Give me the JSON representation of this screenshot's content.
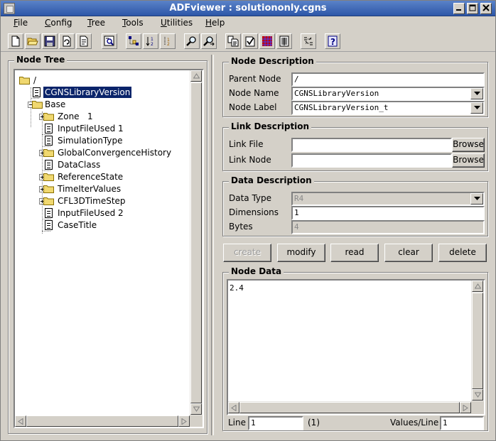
{
  "window": {
    "title": "ADFviewer : solutiononly.cgns",
    "controls": [
      "minimize",
      "maximize",
      "close"
    ]
  },
  "menu": [
    {
      "label": "File",
      "mnemonic": "F",
      "rest": "ile"
    },
    {
      "label": "Config",
      "mnemonic": "C",
      "rest": "onfig"
    },
    {
      "label": "Tree",
      "mnemonic": "T",
      "rest": "ree"
    },
    {
      "label": "Tools",
      "mnemonic": "T",
      "rest": "ools"
    },
    {
      "label": "Utilities",
      "mnemonic": "U",
      "rest": "tilities"
    },
    {
      "label": "Help",
      "mnemonic": "H",
      "rest": "elp"
    }
  ],
  "toolbar_icons": [
    "new-file-icon",
    "open-folder-icon",
    "save-icon",
    "refresh-icon",
    "properties-icon",
    "find-node-icon",
    "tree-expand-icon",
    "tree-sort-icon",
    "tree-numbers-icon",
    "search-icon",
    "search-next-icon",
    "copy-icon",
    "check-icon",
    "plot-icon",
    "table-icon",
    "compare-icon",
    "help-icon"
  ],
  "node_tree": {
    "title": "Node Tree",
    "items": [
      {
        "label": "/",
        "type": "folder",
        "depth": 0
      },
      {
        "label": "CGNSLibraryVersion",
        "type": "doc",
        "depth": 1,
        "selected": true
      },
      {
        "label": "Base",
        "type": "folder",
        "depth": 1,
        "expanded": true
      },
      {
        "label": "Zone   1",
        "type": "folder",
        "depth": 2
      },
      {
        "label": "InputFileUsed 1",
        "type": "doc",
        "depth": 2
      },
      {
        "label": "SimulationType",
        "type": "doc",
        "depth": 2
      },
      {
        "label": "GlobalConvergenceHistory",
        "type": "folder",
        "depth": 2
      },
      {
        "label": "DataClass",
        "type": "doc",
        "depth": 2
      },
      {
        "label": "ReferenceState",
        "type": "folder",
        "depth": 2
      },
      {
        "label": "TimeIterValues",
        "type": "folder",
        "depth": 2
      },
      {
        "label": "CFL3DTimeStep",
        "type": "folder",
        "depth": 2
      },
      {
        "label": "InputFileUsed 2",
        "type": "doc",
        "depth": 2
      },
      {
        "label": "CaseTitle",
        "type": "doc",
        "depth": 2
      }
    ]
  },
  "node_description": {
    "title": "Node Description",
    "parent_node_label": "Parent Node",
    "parent_node_value": "/",
    "node_name_label": "Node Name",
    "node_name_value": "CGNSLibraryVersion",
    "node_label_label": "Node Label",
    "node_label_value": "CGNSLibraryVersion_t"
  },
  "link_description": {
    "title": "Link Description",
    "link_file_label": "Link File",
    "link_file_value": "",
    "link_node_label": "Link Node",
    "link_node_value": "",
    "browse_label": "Browse"
  },
  "data_description": {
    "title": "Data Description",
    "data_type_label": "Data Type",
    "data_type_value": "R4",
    "dimensions_label": "Dimensions",
    "dimensions_value": "1",
    "bytes_label": "Bytes",
    "bytes_value": "4"
  },
  "actions": {
    "create": "create",
    "modify": "modify",
    "read": "read",
    "clear": "clear",
    "delete": "delete"
  },
  "node_data": {
    "title": "Node Data",
    "content": "2.4",
    "line_label": "Line",
    "line_value": "1",
    "line_count": "(1)",
    "values_per_line_label": "Values/Line",
    "values_per_line_value": "1"
  }
}
